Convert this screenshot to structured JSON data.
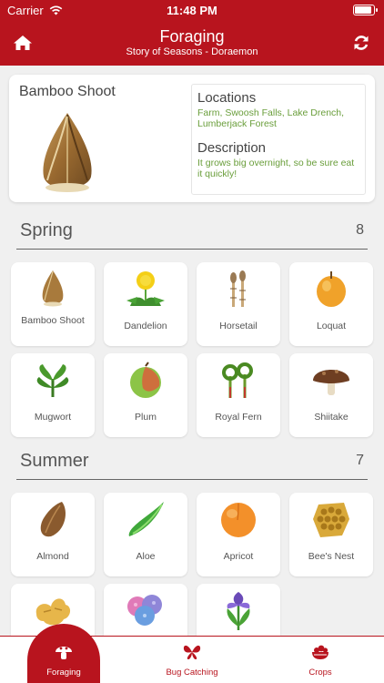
{
  "status": {
    "carrier": "Carrier",
    "time": "11:48 PM"
  },
  "header": {
    "title": "Foraging",
    "subtitle": "Story of Seasons - Doraemon",
    "home_icon": "home-icon",
    "refresh_icon": "refresh-icon"
  },
  "colors": {
    "brand": "#b8141e",
    "green_text": "#6a9e3b"
  },
  "detail": {
    "name": "Bamboo Shoot",
    "locations_title": "Locations",
    "locations": "Farm, Swoosh Falls, Lake Drench, Lumberjack Forest",
    "description_title": "Description",
    "description": "It grows big overnight, so be sure eat it quickly!"
  },
  "spring": {
    "label": "Spring",
    "count": "8",
    "items": [
      {
        "name": "Bamboo Shoot",
        "icon": "bamboo-shoot-icon"
      },
      {
        "name": "Dandelion",
        "icon": "dandelion-icon"
      },
      {
        "name": "Horsetail",
        "icon": "horsetail-icon"
      },
      {
        "name": "Loquat",
        "icon": "loquat-icon"
      },
      {
        "name": "Mugwort",
        "icon": "mugwort-icon"
      },
      {
        "name": "Plum",
        "icon": "plum-icon"
      },
      {
        "name": "Royal Fern",
        "icon": "royal-fern-icon"
      },
      {
        "name": "Shiitake",
        "icon": "shiitake-icon"
      }
    ]
  },
  "summer": {
    "label": "Summer",
    "count": "7",
    "items": [
      {
        "name": "Almond",
        "icon": "almond-icon"
      },
      {
        "name": "Aloe",
        "icon": "aloe-icon"
      },
      {
        "name": "Apricot",
        "icon": "apricot-icon"
      },
      {
        "name": "Bee's Nest",
        "icon": "bees-nest-icon"
      },
      {
        "name": "",
        "icon": "ginger-icon"
      },
      {
        "name": "",
        "icon": "hydrangea-icon"
      },
      {
        "name": "",
        "icon": "iris-icon"
      }
    ]
  },
  "tabs": [
    {
      "label": "Foraging",
      "icon": "mushroom-icon",
      "active": true
    },
    {
      "label": "Bug Catching",
      "icon": "butterfly-icon",
      "active": false
    },
    {
      "label": "Crops",
      "icon": "bowl-icon",
      "active": false
    }
  ]
}
